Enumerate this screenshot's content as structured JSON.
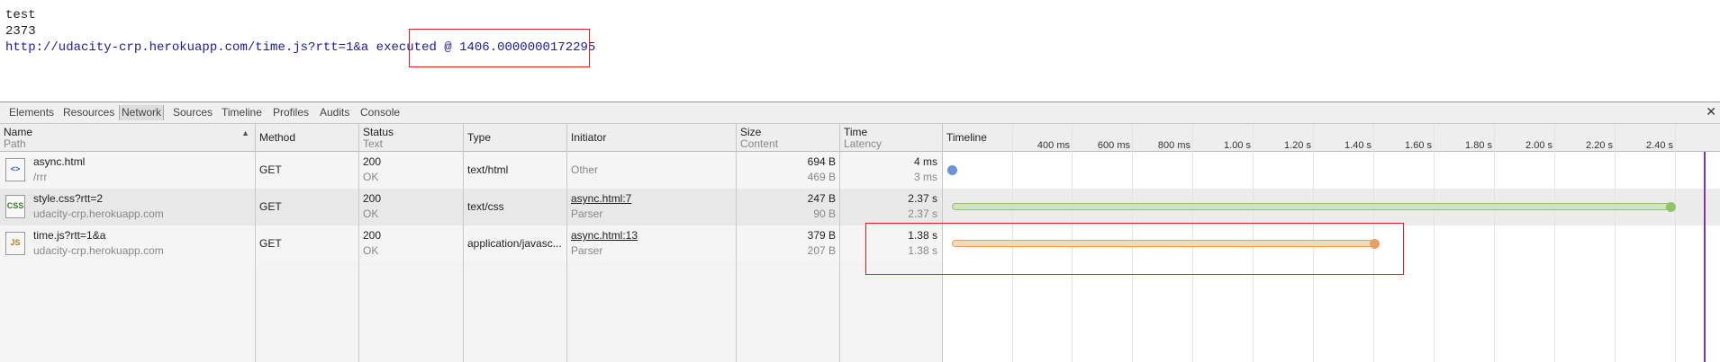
{
  "page": {
    "line1": "test",
    "line2": "2373",
    "line3_url": "http://udacity-crp.herokuapp.com/time.js?rtt=1&a",
    "line3_text": " executed @ 1406.0000000172295"
  },
  "devtools": {
    "tabs": [
      "Elements",
      "Resources",
      "Network",
      "Sources",
      "Timeline",
      "Profiles",
      "Audits",
      "Console"
    ],
    "active_tab": "Network",
    "close_glyph": "✕"
  },
  "network": {
    "columns": {
      "name": "Name",
      "path": "Path",
      "method": "Method",
      "status": "Status",
      "status_sub": "Text",
      "type": "Type",
      "initiator": "Initiator",
      "size": "Size",
      "size_sub": "Content",
      "time": "Time",
      "time_sub": "Latency",
      "timeline": "Timeline"
    },
    "timeline_ticks": [
      "400 ms",
      "600 ms",
      "800 ms",
      "1.00 s",
      "1.20 s",
      "1.40 s",
      "1.60 s",
      "1.80 s",
      "2.00 s",
      "2.20 s",
      "2.40 s"
    ],
    "rows": [
      {
        "icon": "html-file-icon",
        "icon_text": "<>",
        "name": "async.html",
        "path": "/rrr",
        "method": "GET",
        "status": "200",
        "status_text": "OK",
        "type": "text/html",
        "initiator": "Other",
        "initiator_sub": "",
        "size": "694 B",
        "content": "469 B",
        "time": "4 ms",
        "latency": "3 ms",
        "bar_color": "#8ab0e8",
        "dot_color": "#6a93d8"
      },
      {
        "icon": "css-file-icon",
        "icon_text": "CSS",
        "name": "style.css?rtt=2",
        "path": "udacity-crp.herokuapp.com",
        "method": "GET",
        "status": "200",
        "status_text": "OK",
        "type": "text/css",
        "initiator": "async.html:7",
        "initiator_sub": "Parser",
        "size": "247 B",
        "content": "90 B",
        "time": "2.37 s",
        "latency": "2.37 s",
        "bar_color": "#cfe5b8",
        "dot_color": "#8fc46a"
      },
      {
        "icon": "js-file-icon",
        "icon_text": "JS",
        "name": "time.js?rtt=1&a",
        "path": "udacity-crp.herokuapp.com",
        "method": "GET",
        "status": "200",
        "status_text": "OK",
        "type": "application/javasc...",
        "initiator": "async.html:13",
        "initiator_sub": "Parser",
        "size": "379 B",
        "content": "207 B",
        "time": "1.38 s",
        "latency": "1.38 s",
        "bar_color": "#f6d9b0",
        "dot_color": "#e8a060"
      }
    ]
  }
}
